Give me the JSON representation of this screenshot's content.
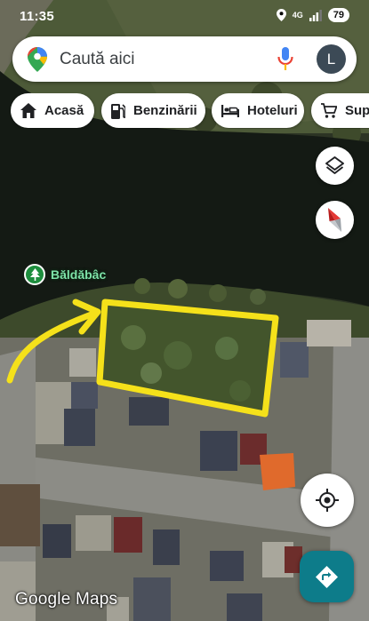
{
  "status_bar": {
    "time": "11:35",
    "network": "4G",
    "battery": "79"
  },
  "search": {
    "placeholder": "Caută aici",
    "avatar_letter": "L"
  },
  "chips": [
    {
      "label": "Acasă",
      "icon": "home-icon"
    },
    {
      "label": "Benzinării",
      "icon": "gas-station-icon"
    },
    {
      "label": "Hoteluri",
      "icon": "bed-icon"
    },
    {
      "label": "Supe",
      "icon": "shopping-cart-icon"
    }
  ],
  "map": {
    "place_label": "Băldăbâc",
    "attribution": "Google Maps",
    "annotation_color": "#f5e11a",
    "water_color": "#141a14"
  },
  "controls": {
    "layers": "layers-icon",
    "compass": "compass-icon",
    "my_location": "my-location-icon",
    "directions": "directions-icon"
  }
}
